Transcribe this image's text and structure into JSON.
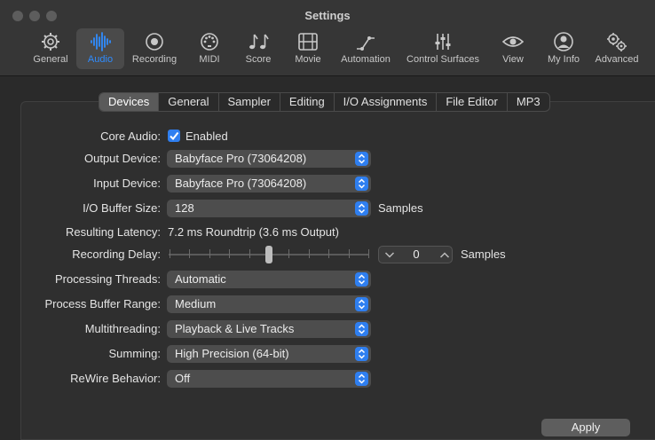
{
  "window": {
    "title": "Settings"
  },
  "toolbar": {
    "items": [
      {
        "label": "General",
        "icon": "gear-icon"
      },
      {
        "label": "Audio",
        "icon": "waveform-icon",
        "active": true
      },
      {
        "label": "Recording",
        "icon": "record-icon"
      },
      {
        "label": "MIDI",
        "icon": "midi-port-icon"
      },
      {
        "label": "Score",
        "icon": "music-notes-icon"
      },
      {
        "label": "Movie",
        "icon": "film-icon"
      },
      {
        "label": "Automation",
        "icon": "automation-curve-icon"
      },
      {
        "label": "Control Surfaces",
        "icon": "faders-icon"
      },
      {
        "label": "View",
        "icon": "eye-icon"
      },
      {
        "label": "My Info",
        "icon": "person-icon"
      },
      {
        "label": "Advanced",
        "icon": "gears-icon"
      }
    ]
  },
  "tabs": [
    "Devices",
    "General",
    "Sampler",
    "Editing",
    "I/O Assignments",
    "File Editor",
    "MP3"
  ],
  "active_tab": "Devices",
  "devices": {
    "core_audio_label": "Core Audio:",
    "core_audio_value": "Enabled",
    "core_audio_checked": true,
    "output_device_label": "Output Device:",
    "output_device_value": "Babyface Pro (73064208)",
    "input_device_label": "Input Device:",
    "input_device_value": "Babyface Pro (73064208)",
    "buffer_label": "I/O Buffer Size:",
    "buffer_value": "128",
    "buffer_unit": "Samples",
    "latency_label": "Resulting Latency:",
    "latency_value": "7.2 ms Roundtrip (3.6 ms Output)",
    "rec_delay_label": "Recording Delay:",
    "rec_delay_value": "0",
    "rec_delay_unit": "Samples",
    "threads_label": "Processing Threads:",
    "threads_value": "Automatic",
    "buffer_range_label": "Process Buffer Range:",
    "buffer_range_value": "Medium",
    "multithreading_label": "Multithreading:",
    "multithreading_value": "Playback & Live Tracks",
    "summing_label": "Summing:",
    "summing_value": "High Precision (64-bit)",
    "rewire_label": "ReWire Behavior:",
    "rewire_value": "Off"
  },
  "apply_label": "Apply",
  "colors": {
    "accent": "#2f7ff0",
    "active_label": "#2f8cff"
  }
}
